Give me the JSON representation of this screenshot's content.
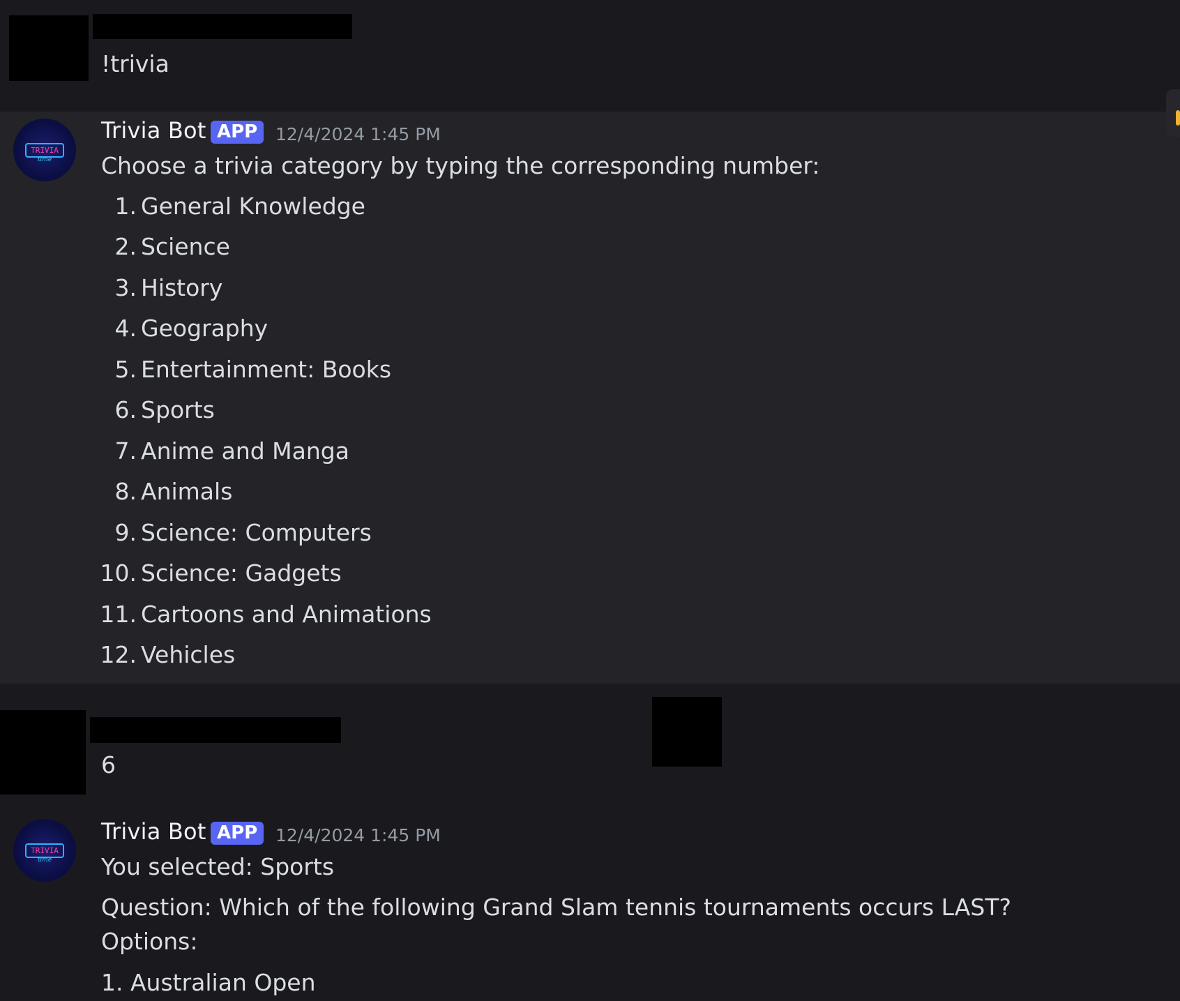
{
  "messages": [
    {
      "text": "!trivia"
    },
    {
      "author": "Trivia Bot",
      "badge": "APP",
      "timestamp": "12/4/2024 1:45 PM",
      "intro": "Choose a trivia category by typing the corresponding number:",
      "options": [
        {
          "num": "1.",
          "label": "General Knowledge"
        },
        {
          "num": "2.",
          "label": "Science"
        },
        {
          "num": "3.",
          "label": "History"
        },
        {
          "num": "4.",
          "label": "Geography"
        },
        {
          "num": "5.",
          "label": "Entertainment: Books"
        },
        {
          "num": "6.",
          "label": "Sports"
        },
        {
          "num": "7.",
          "label": "Anime and Manga"
        },
        {
          "num": "8.",
          "label": "Animals"
        },
        {
          "num": "9.",
          "label": "Science: Computers"
        },
        {
          "num": "10.",
          "label": "Science: Gadgets"
        },
        {
          "num": "11.",
          "label": "Cartoons and Animations"
        },
        {
          "num": "12.",
          "label": "Vehicles"
        }
      ]
    },
    {
      "text": "6"
    },
    {
      "author": "Trivia Bot",
      "badge": "APP",
      "timestamp": "12/4/2024 1:45 PM",
      "selected": "You selected: Sports",
      "question": "Question: Which of the following Grand Slam tennis tournaments occurs LAST?",
      "options_label": "Options:",
      "first_option": "1. Australian Open"
    }
  ],
  "bot_avatar": {
    "icon": "trivia-time-neon-logo",
    "logo_text": "TRIVIA",
    "logo_subtext": "time"
  },
  "colors": {
    "background": "#1a1a1e",
    "highlight": "#232328",
    "badge": "#5865f2",
    "timestamp": "#949ba4",
    "text": "#dbdee1"
  }
}
